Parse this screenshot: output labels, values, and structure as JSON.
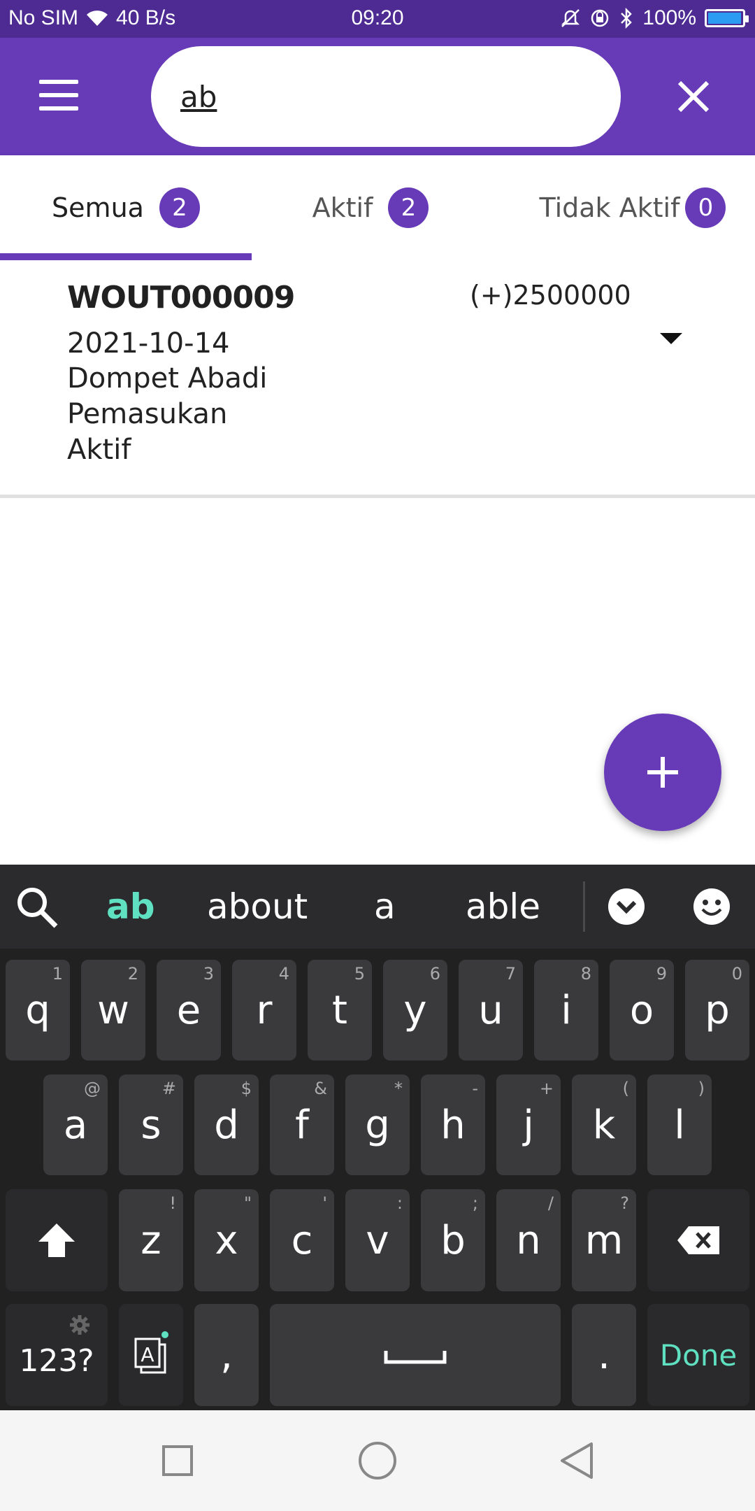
{
  "status_bar": {
    "carrier": "No SIM",
    "speed": "40 B/s",
    "time": "09:20",
    "battery": "100%"
  },
  "app_bar": {
    "search_value": "ab"
  },
  "tabs": [
    {
      "label": "Semua",
      "count": "2",
      "active": true
    },
    {
      "label": "Aktif",
      "count": "2",
      "active": false
    },
    {
      "label": "Tidak Aktif",
      "count": "0",
      "active": false
    }
  ],
  "list": {
    "items": [
      {
        "code": "WOUT000009",
        "date": "2021-10-14",
        "wallet": "Dompet Abadi",
        "type": "Pemasukan",
        "status": "Aktif",
        "amount": "(+)2500000"
      }
    ]
  },
  "fab": {
    "icon": "plus-icon"
  },
  "keyboard": {
    "suggestions": [
      "ab",
      "about",
      "a",
      "able"
    ],
    "row1": [
      {
        "key": "q",
        "hint": "1"
      },
      {
        "key": "w",
        "hint": "2"
      },
      {
        "key": "e",
        "hint": "3"
      },
      {
        "key": "r",
        "hint": "4"
      },
      {
        "key": "t",
        "hint": "5"
      },
      {
        "key": "y",
        "hint": "6"
      },
      {
        "key": "u",
        "hint": "7"
      },
      {
        "key": "i",
        "hint": "8"
      },
      {
        "key": "o",
        "hint": "9"
      },
      {
        "key": "p",
        "hint": "0"
      }
    ],
    "row2": [
      {
        "key": "a",
        "hint": "@"
      },
      {
        "key": "s",
        "hint": "#"
      },
      {
        "key": "d",
        "hint": "$"
      },
      {
        "key": "f",
        "hint": "&"
      },
      {
        "key": "g",
        "hint": "*"
      },
      {
        "key": "h",
        "hint": "-"
      },
      {
        "key": "j",
        "hint": "+"
      },
      {
        "key": "k",
        "hint": "("
      },
      {
        "key": "l",
        "hint": ")"
      }
    ],
    "row3": [
      {
        "key": "z",
        "hint": "!"
      },
      {
        "key": "x",
        "hint": "\""
      },
      {
        "key": "c",
        "hint": "'"
      },
      {
        "key": "v",
        "hint": ":"
      },
      {
        "key": "b",
        "hint": ";"
      },
      {
        "key": "n",
        "hint": "/"
      },
      {
        "key": "m",
        "hint": "?"
      }
    ],
    "numbers_label": "123?",
    "comma": ",",
    "period": ".",
    "done_label": "Done"
  },
  "colors": {
    "primary": "#673ab7",
    "status_bar": "#4d2b93",
    "keyboard_bg": "#212121",
    "accent_suggestion": "#5fe0c0"
  }
}
